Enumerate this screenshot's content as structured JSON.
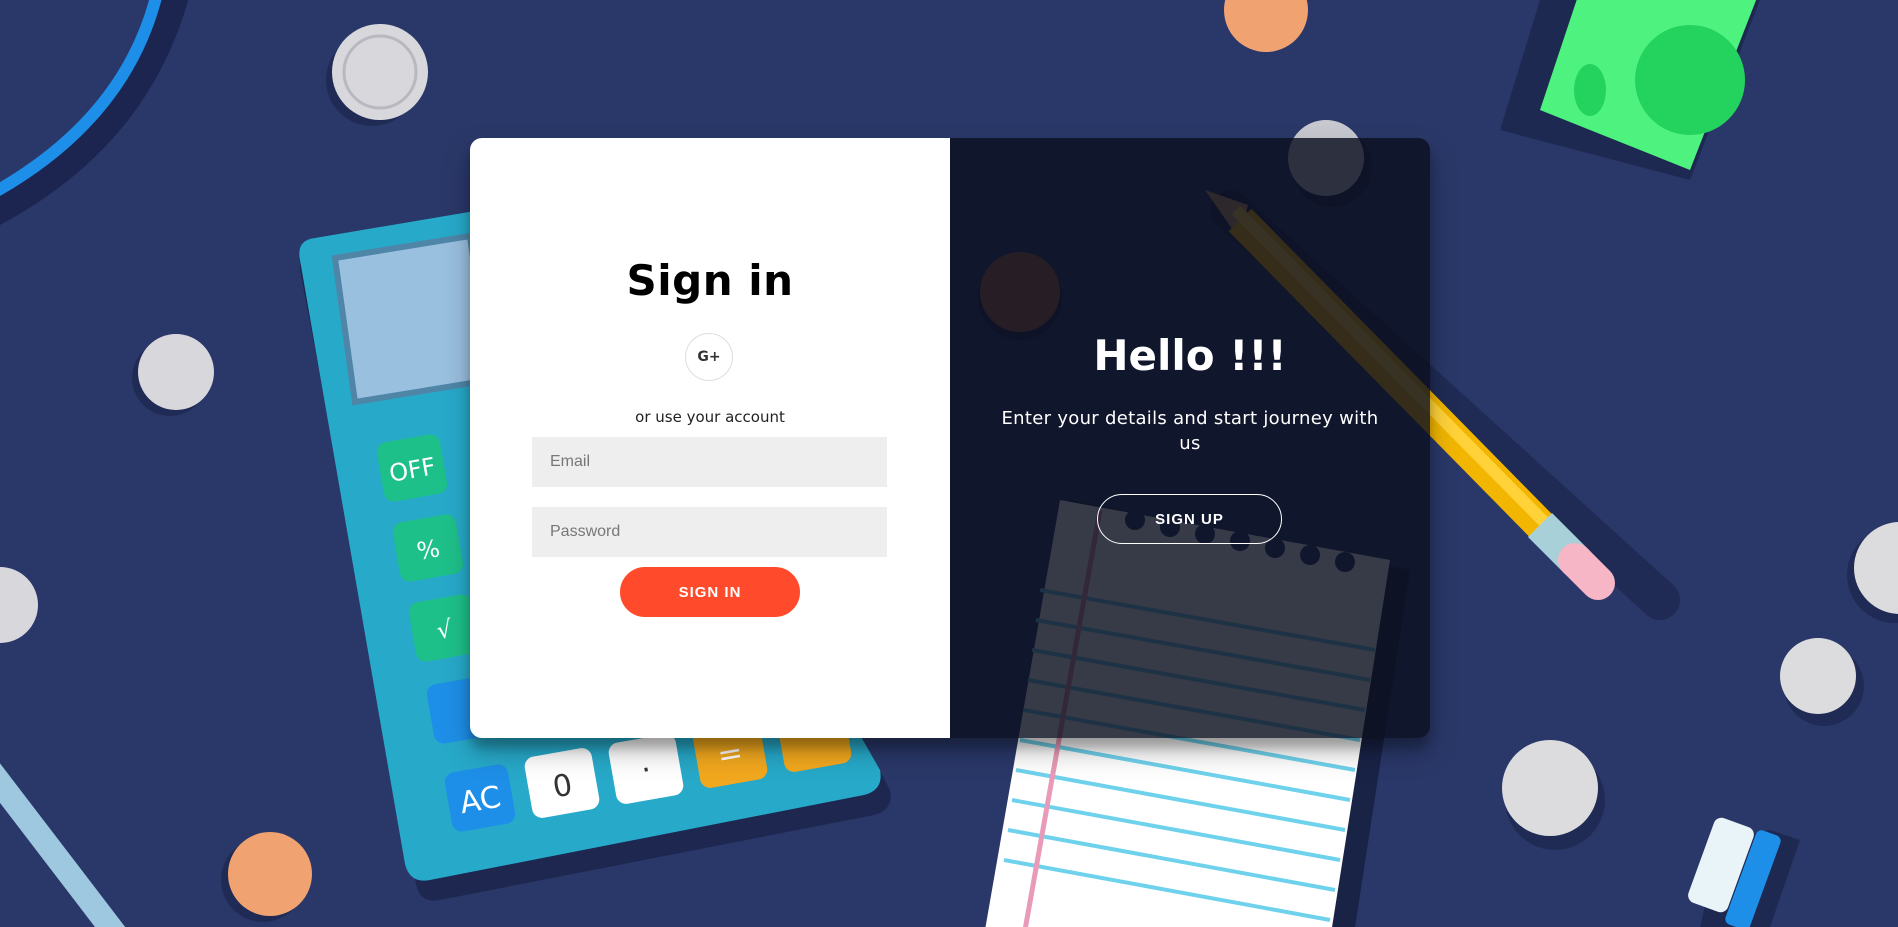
{
  "signin": {
    "title": "Sign in",
    "social_google_label": "G+",
    "use_account_text": "or use your account",
    "email_placeholder": "Email",
    "password_placeholder": "Password",
    "button_label": "SIGN IN"
  },
  "overlay": {
    "title": "Hello !!!",
    "text": "Enter your details and start journey with us",
    "button_label": "SIGN UP"
  },
  "background": {
    "calculator_keys": [
      "OFF",
      "%",
      "√",
      "AC",
      "0",
      "·",
      "="
    ],
    "icons": [
      "calculator-illustration",
      "pencil-illustration",
      "notepad-illustration",
      "coin-illustration",
      "cash-illustration",
      "toothbrush-illustration"
    ]
  },
  "colors": {
    "background": "#2a3869",
    "accent": "#ff4b2b",
    "panel_dark": "#0b0f1e"
  }
}
